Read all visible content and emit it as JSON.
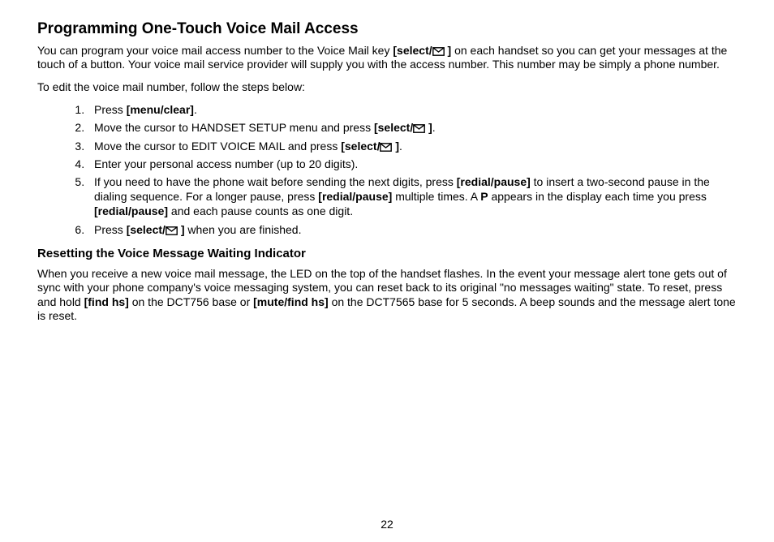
{
  "title": "Programming One-Touch Voice Mail Access",
  "intro": {
    "part1": "You can program your voice mail access number to the Voice Mail key ",
    "select_label": "[select/",
    "select_close": " ]",
    "part2": " on each handset so you can get your messages at the touch of a button. Your voice mail service provider will supply you with the access number. This number may be simply a phone number."
  },
  "edit_intro": "To edit the voice mail number, follow the steps below:",
  "steps": {
    "s1a": "Press ",
    "s1b": "[menu/clear]",
    "s1c": ".",
    "s2a": "Move the cursor to HANDSET SETUP menu and press ",
    "s3a": "Move the cursor to EDIT VOICE MAIL and press ",
    "s4": "Enter your personal access number (up to 20 digits).",
    "s5a": "If you need to have the phone wait before sending the next digits, press ",
    "s5b": "[redial/pause]",
    "s5c": " to insert a two-second pause in the dialing sequence.  For a longer pause, press ",
    "s5d": "[redial/pause]",
    "s5e": " multiple times. A ",
    "s5f": "P",
    "s5g": " appears in the display each time you press ",
    "s5h": "[redial/pause]",
    "s5i": " and each pause counts as one digit.",
    "s6a": "Press ",
    "s6b": " when you are finished."
  },
  "subhead": "Resetting the Voice Message Waiting Indicator",
  "reset": {
    "p1": "When you receive a new voice mail message, the LED on the top of the handset flashes. In the event your message alert tone gets out of sync with your phone company's voice messaging system, you can reset back to its original \"no messages waiting\" state. To reset, press and hold ",
    "b1": "[find hs]",
    "p2": " on the DCT756 base or ",
    "b2": "[mute/find hs]",
    "p3": " on the DCT7565 base for 5 seconds. A beep sounds and the message alert tone is reset."
  },
  "page_number": "22"
}
